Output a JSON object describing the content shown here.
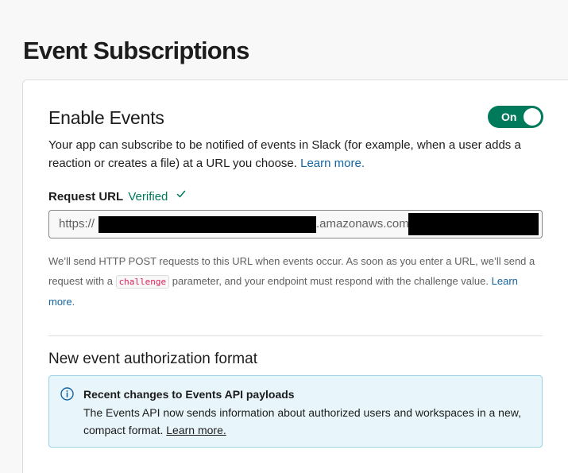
{
  "page": {
    "title": "Event Subscriptions"
  },
  "enable_events": {
    "title": "Enable Events",
    "toggle_label": "On",
    "toggle_on": true,
    "description": "Your app can subscribe to be notified of events in Slack (for example, when a user adds a reaction or creates a file) at a URL you choose.",
    "learn_more": "Learn more."
  },
  "request_url": {
    "label": "Request URL",
    "status": "Verified",
    "value_prefix": "https://",
    "value_middle": ".amazonaws.com",
    "help_before_code": "We’ll send HTTP POST requests to this URL when events occur. As soon as you enter a URL, we’ll send a request with a",
    "help_code": "challenge",
    "help_after_code": "parameter, and your endpoint must respond with the challenge value.",
    "help_learn_more": "Learn more."
  },
  "auth_format": {
    "title": "New event authorization format",
    "info_title": "Recent changes to Events API payloads",
    "info_body": "The Events API now sends information about authorized users and workspaces in a new, compact format.",
    "info_learn_more": "Learn more."
  },
  "colors": {
    "toggle_on": "#007a5a",
    "link": "#1264a3",
    "verified": "#007a5a",
    "code": "#e01e5a",
    "info_bg": "#e8f5fa",
    "info_border": "#9ed2e6"
  },
  "icons": {
    "verified_check": "check-icon",
    "info": "info-circle-icon"
  }
}
